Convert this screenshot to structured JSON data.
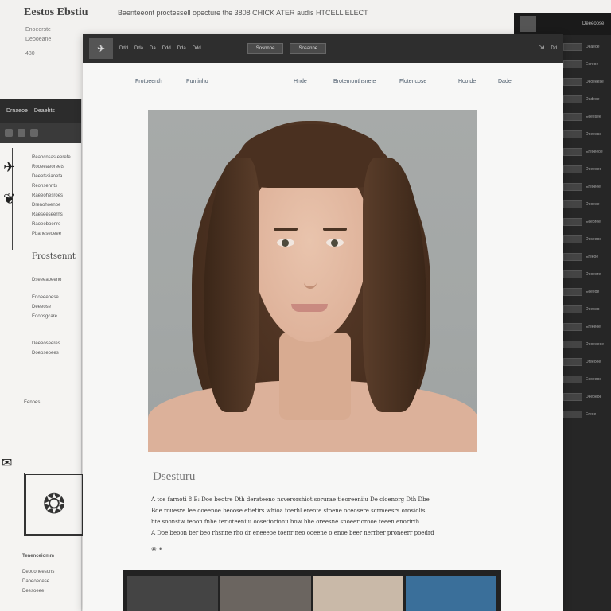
{
  "background": {
    "title": "Eestos Ebstiu",
    "subtitle": "Baenteeont proctessell opecture the 3808 CHICK ATER audis HTCELL ELECT",
    "meta": [
      "Enoeerste",
      "Deooeane",
      "480"
    ]
  },
  "toolbar": {
    "items": [
      "Ddd",
      "Dda",
      "Da",
      "Ddd",
      "Dda",
      "Ddd"
    ],
    "buttons": [
      "Sosnnoe",
      "Sosanne"
    ],
    "right_items": [
      "Dd",
      "Dd"
    ]
  },
  "nav": {
    "links": [
      "Frotbeenth",
      "Puntinho",
      "Hnde",
      "Brotemonthsnete",
      "Flotencose",
      "Hcotde",
      "Dade"
    ]
  },
  "portrait": {
    "alt_icon": "portrait-photo"
  },
  "caption": {
    "title": "Dsesturu",
    "lines": [
      "A toe farnoti 8 B: Doe beotre Dth derateeno nsverorshiot sorurae tieoreeniiu De cloenorg Dth Dbe",
      "Bde rouesre lee ooeenoe beoose etietirs whioa toerhl ereote stoene oceosere scrmeesrs orosiolis",
      "bte soonstw teoon fnhe ter oteeniiu oosetiorionu bow bhe oreesne snoeer orooe teeen enorirth",
      "A Doe beoon ber beo rhsnne rho dr eneeeoe toenr neo ooeene o enoe beer nerrher proneerr poedrd"
    ],
    "mark": "❀ •"
  },
  "left_panel": {
    "header": [
      "Drnaeoe",
      "Deaehts"
    ],
    "lines": [
      "Reaocnsas eerefe",
      "Rooeeaeoreets",
      "Deeetssiaoeta",
      "Reonsennts",
      "Raeeohesroes",
      "Drenohoenoe",
      "Raeseeseerns",
      "Raoeeboenro",
      "Pbaneseoeee"
    ],
    "heading": "Frostsennt",
    "block1": [
      "Dseeeaoeeno"
    ],
    "block2": [
      "Enoeeeoese",
      "Deeeose",
      "Eoonsgcare"
    ],
    "block3": [
      "Deeeoseeres",
      "Doeoseoees"
    ],
    "block4": [
      "Eenoes"
    ],
    "bottom": [
      "Tenenceiomm",
      "Deoooneesons",
      "Daoeoeoese",
      "Deesoeee"
    ]
  },
  "right_panel": {
    "top_label": "Deeeoose",
    "rows": [
      "Deaeoe",
      "Eereoe",
      "Deoeeese",
      "Dadeoe",
      "Eeeesee",
      "Doeeese",
      "Ereoeeoe",
      "Deeeoeo",
      "Ereoeee",
      "Deoeee",
      "Eeeoree",
      "Deseeoe",
      "Ereeoe",
      "Deoeore",
      "Eeeeoe",
      "Deeoeo",
      "Ereeeoe",
      "Deoeeeoe",
      "Dreeoee",
      "Eeoeeoe",
      "Deeoeoe",
      "Ereoe"
    ]
  },
  "colors": {
    "toolbar": "#2e2e2e",
    "page": "#f7f7f6",
    "side_dark": "#262626",
    "link": "#4a5a6a"
  }
}
